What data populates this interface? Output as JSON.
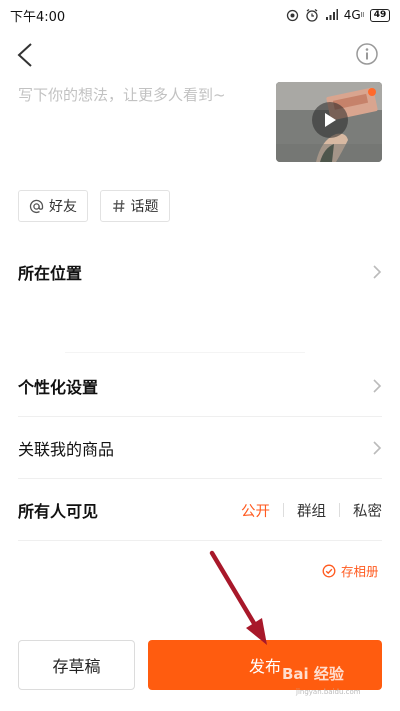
{
  "status_bar": {
    "time": "下午4:00",
    "network": "4G",
    "network_sup": "ll",
    "battery": "49",
    "icons": [
      "hotspot-icon",
      "alarm-icon",
      "signal-icon",
      "network-icon",
      "battery-icon"
    ]
  },
  "header": {
    "back_icon": "chevron-left-icon",
    "info_icon": "info-icon"
  },
  "composer": {
    "placeholder": "写下你的想法，让更多人看到~",
    "video_thumbnail_icon": "play-icon"
  },
  "chips": [
    {
      "label": "好友",
      "icon": "at-sign-icon"
    },
    {
      "label": "话题",
      "icon": "hash-icon"
    }
  ],
  "settings": {
    "location": "所在位置",
    "personalization": "个性化设置",
    "link_products": "关联我的商品",
    "visibility": {
      "label": "所有人可见",
      "options": [
        "公开",
        "群组",
        "私密"
      ],
      "selected": "公开"
    }
  },
  "save_to_album": {
    "label": "存相册",
    "checked": true
  },
  "actions": {
    "draft": "存草稿",
    "publish": "发布"
  },
  "watermark": {
    "text": "Bai 经验",
    "url": "jingyan.baidu.com"
  },
  "colors": {
    "accent": "#ff5a1f",
    "publish_bg": "#ff5c0f",
    "annotation_arrow": "#a8182a",
    "placeholder": "#c2c2c2"
  }
}
